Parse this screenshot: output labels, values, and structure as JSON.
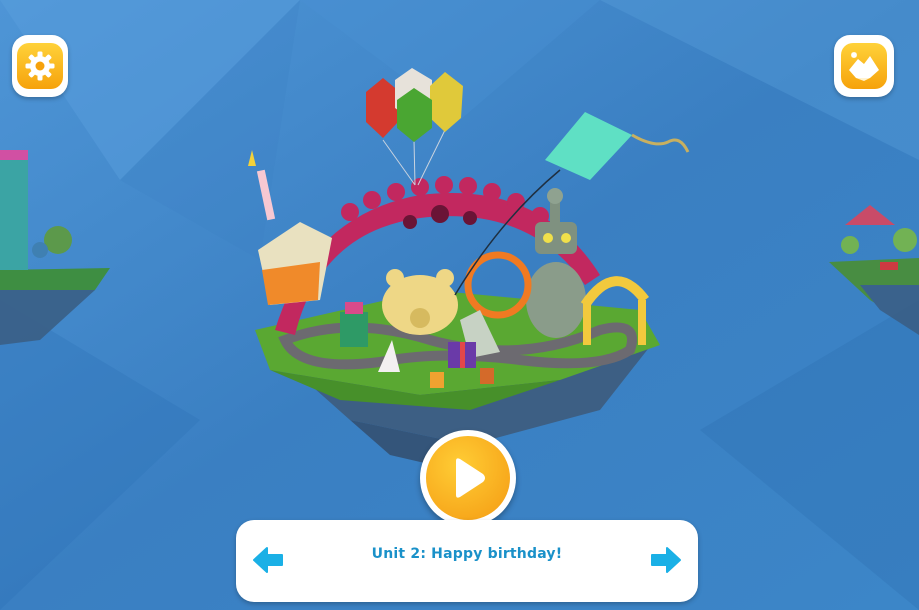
{
  "unit": {
    "title": "Unit 2: Happy birthday!"
  },
  "icons": {
    "settings": "gear-icon",
    "map": "island-map-icon",
    "play": "play-icon",
    "prev": "arrow-left-icon",
    "next": "arrow-right-icon"
  },
  "colors": {
    "background": "#3f86c9",
    "accent": "#f6a20b",
    "title": "#1a91c9",
    "arrow": "#1ab0e6"
  }
}
